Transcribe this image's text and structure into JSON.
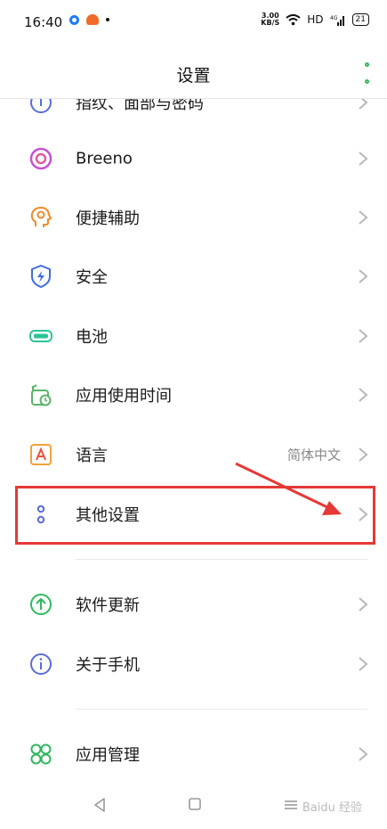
{
  "status_bar": {
    "time": "16:40",
    "net_speed_value": "3.00",
    "net_speed_unit": "KB/S",
    "hd": "HD",
    "signal": "4G",
    "battery": "21"
  },
  "header": {
    "title": "设置"
  },
  "partial_item": {
    "label": "指纹、面部与密码"
  },
  "items": [
    {
      "label": "Breeno"
    },
    {
      "label": "便捷辅助"
    },
    {
      "label": "安全"
    },
    {
      "label": "电池"
    },
    {
      "label": "应用使用时间"
    },
    {
      "label": "语言",
      "value": "简体中文"
    },
    {
      "label": "其他设置"
    },
    {
      "label": "软件更新"
    },
    {
      "label": "关于手机"
    },
    {
      "label": "应用管理"
    }
  ],
  "watermark": "Baidu 经验"
}
